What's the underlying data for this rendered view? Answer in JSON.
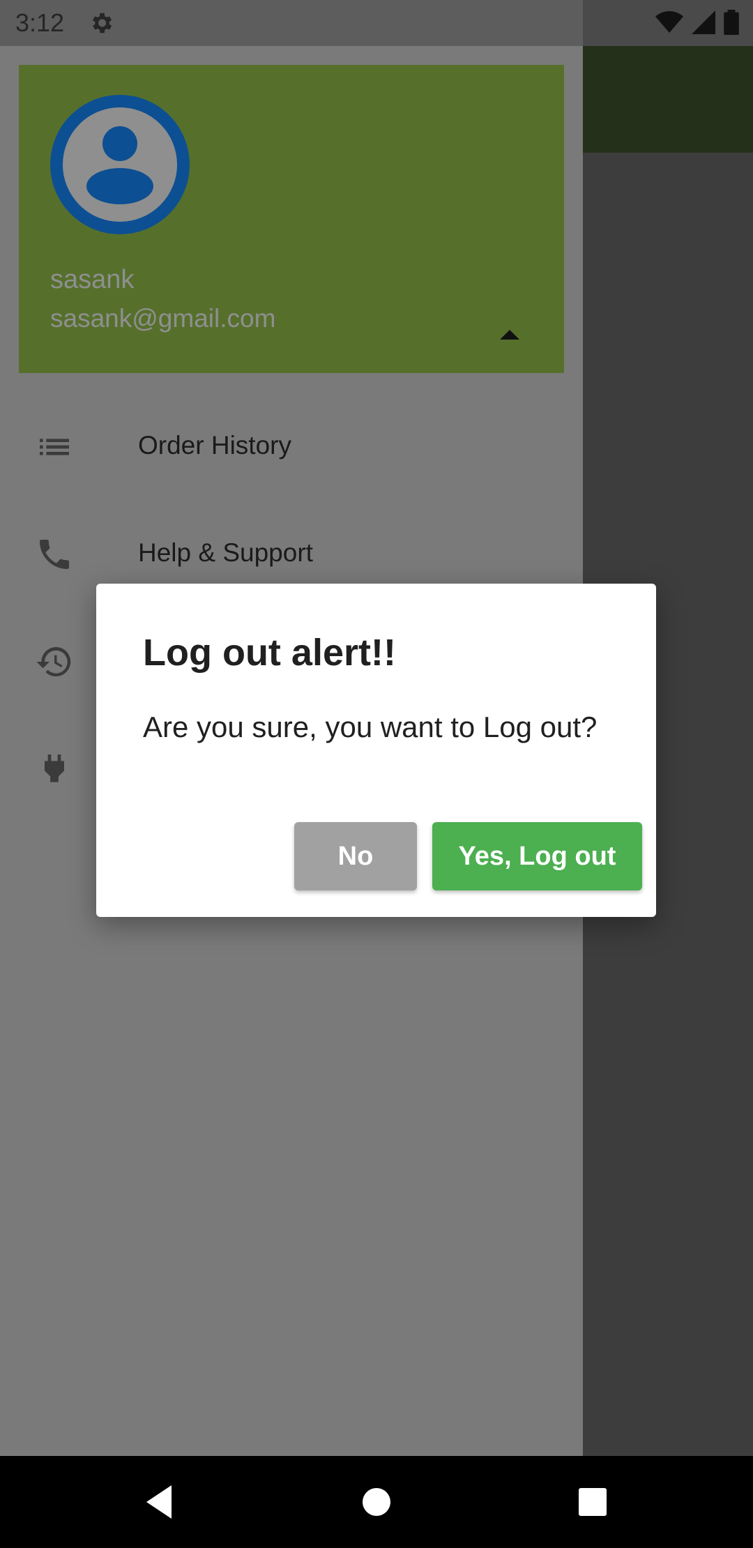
{
  "status_bar": {
    "time": "3:12",
    "icons": [
      "settings-icon",
      "wifi-icon",
      "signal-icon",
      "battery-icon"
    ]
  },
  "drawer": {
    "user": {
      "name": "sasank",
      "email": "sasank@gmail.com"
    },
    "menu_items": [
      {
        "label": "Order History",
        "icon": "list-icon"
      },
      {
        "label": "Help & Support",
        "icon": "phone-icon"
      },
      {
        "label": "",
        "icon": "history-icon"
      },
      {
        "label": "",
        "icon": "plug-icon"
      }
    ]
  },
  "dialog": {
    "title": "Log out alert!!",
    "message": "Are you sure, you want to Log out?",
    "no_label": "No",
    "yes_label": "Yes, Log out"
  },
  "colors": {
    "header_green": "#56702c",
    "confirm_green": "#4caf50",
    "cancel_grey": "#a1a1a1",
    "avatar_blue": "#0d4f93"
  },
  "nav_bar": {
    "buttons": [
      "back-icon",
      "home-icon",
      "recents-icon"
    ]
  }
}
